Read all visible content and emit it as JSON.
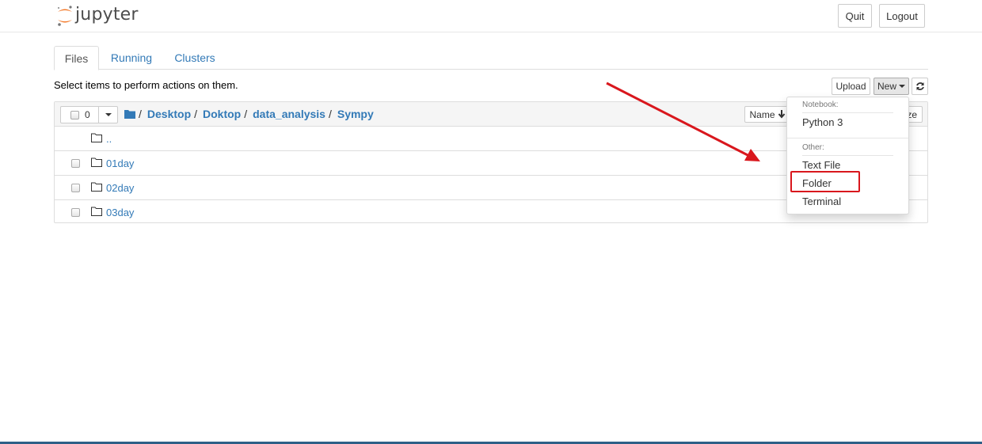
{
  "header": {
    "logo_text": "jupyter",
    "quit_label": "Quit",
    "logout_label": "Logout"
  },
  "tabs": [
    {
      "label": "Files",
      "active": true
    },
    {
      "label": "Running",
      "active": false
    },
    {
      "label": "Clusters",
      "active": false
    }
  ],
  "toolbar": {
    "instructions": "Select items to perform actions on them.",
    "upload_label": "Upload",
    "new_label": "New"
  },
  "list_header": {
    "selected_count": "0",
    "breadcrumb": [
      "Desktop",
      "Doktop",
      "data_analysis",
      "Sympy"
    ],
    "name_sort_label": "Name",
    "size_sort_label": "ze"
  },
  "rows": [
    {
      "name": "..",
      "checkbox": false,
      "meta": ""
    },
    {
      "name": "01day",
      "checkbox": true,
      "meta": ""
    },
    {
      "name": "02day",
      "checkbox": true,
      "meta": ""
    },
    {
      "name": "03day",
      "checkbox": true,
      "meta": ""
    }
  ],
  "new_menu": {
    "notebook_header": "Notebook:",
    "python_label": "Python 3",
    "other_header": "Other:",
    "text_file_label": "Text File",
    "folder_label": "Folder",
    "terminal_label": "Terminal"
  },
  "colors": {
    "link": "#337ab7",
    "annotation_red": "#d9171d",
    "logo_orange": "#f37726"
  }
}
